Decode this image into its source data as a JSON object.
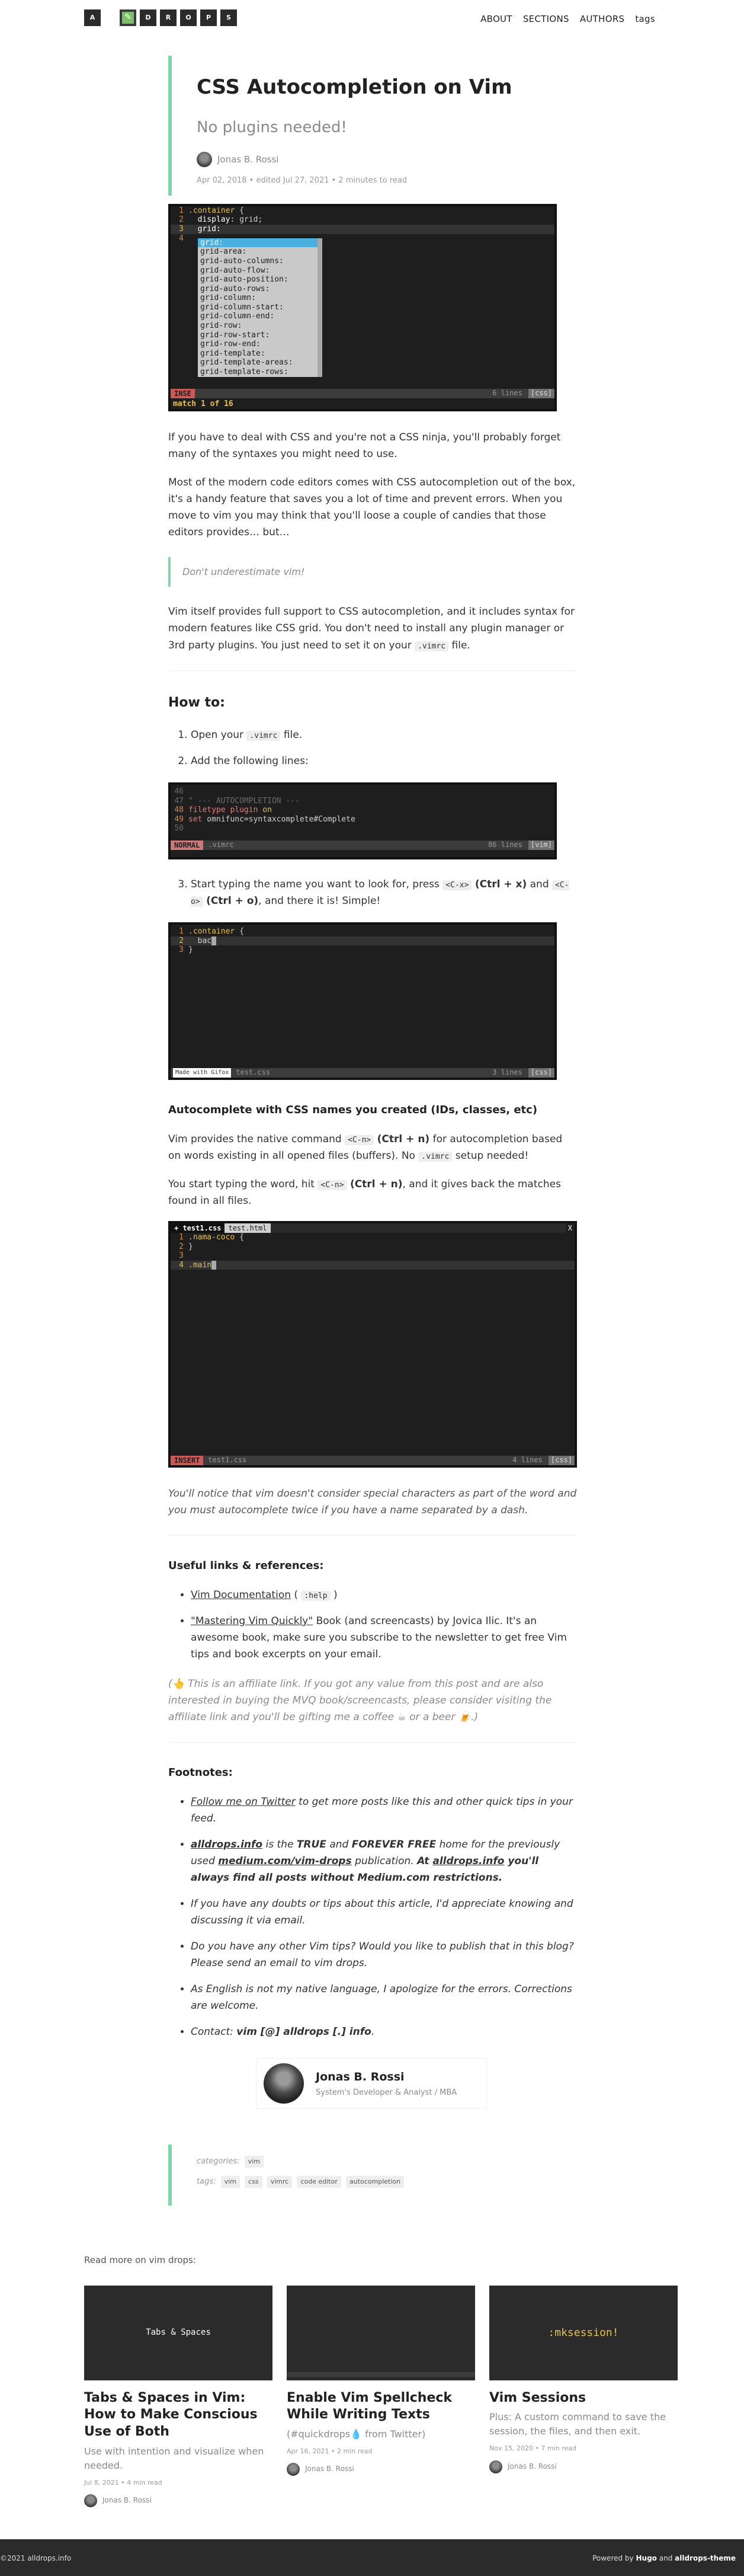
{
  "header": {
    "logo_letters": [
      "A",
      "D",
      "R",
      "O",
      "P",
      "S"
    ],
    "nav": [
      "ABOUT",
      "SECTIONS",
      "AUTHORS",
      "tags"
    ]
  },
  "post": {
    "title": "CSS Autocompletion on Vim",
    "subtitle": "No plugins needed!",
    "author": "Jonas B. Rossi",
    "meta": "Apr 02, 2018 • edited Jul 27, 2021 • 2 minutes to read"
  },
  "term1": {
    "lines": [
      {
        "n": "1",
        "pre": "",
        "sel": ".container",
        "rest": " {"
      },
      {
        "n": "2",
        "pre": "  ",
        "prop": "display",
        "rest": ": grid;"
      },
      {
        "n": "3",
        "pre": "  grid:",
        "rest": ""
      },
      {
        "n": "4",
        "pre": "",
        "rest": ""
      }
    ],
    "popup": [
      "grid:",
      "grid-area:",
      "grid-auto-columns:",
      "grid-auto-flow:",
      "grid-auto-position:",
      "grid-auto-rows:",
      "grid-column:",
      "grid-column-start:",
      "grid-column-end:",
      "grid-row:",
      "grid-row-start:",
      "grid-row-end:",
      "grid-template:",
      "grid-template-areas:",
      "grid-template-rows:"
    ],
    "status_mode": "INSE",
    "status_right": "6 lines",
    "status_tag": "[css]",
    "message": "match 1 of 16"
  },
  "body": {
    "p1": "If you have to deal with CSS and you're not a CSS ninja, you'll probably forget many of the syntaxes you might need to use.",
    "p2": "Most of the modern code editors comes with CSS autocompletion out of the box, it's a handy feature that saves you a lot of time and prevent errors. When you move to vim you may think that you'll loose a couple of candies that those editors provides… but…",
    "quote": "Don't underestimate vim!",
    "p3a": "Vim itself provides full support to CSS autocompletion, and it includes syntax for modern features like CSS grid. You don't need to install any plugin manager or 3rd party plugins. You just need to set it on your",
    "p3_code": ".vimrc",
    "p3b": "file.",
    "howto": "How to:",
    "step1a": "Open your",
    "step1_code": ".vimrc",
    "step1b": "file.",
    "step2": "Add the following lines:",
    "step3a": "Start typing the name you want to look for, press",
    "step3_code1": "<C-x>",
    "step3_k1": "(Ctrl + x)",
    "step3_and": "and",
    "step3_code2": "<C-o>",
    "step3_k2": "(Ctrl + o)",
    "step3b": ", and there it is! Simple!",
    "sub_head": "Autocomplete with CSS names you created (IDs, classes, etc)",
    "p4a": "Vim provides the native command",
    "p4_code": "<C-n>",
    "p4_k": "(Ctrl + n)",
    "p4b": "for autocompletion based on words existing in all opened files (buffers). No",
    "p4_code2": ".vimrc",
    "p4c": "setup needed!",
    "p5a": "You start typing the word, hit",
    "p5_code": "<C-n>",
    "p5_k": "(Ctrl + n)",
    "p5b": ", and it gives back the matches found in all files.",
    "note": "You'll notice that vim doesn't consider special characters as part of the word and you must autocomplete twice if you have a name separated by a dash.",
    "links_head": "Useful links & references:",
    "link1": "Vim Documentation",
    "link1_code": ":help",
    "link2": "\"Mastering Vim Quickly\"",
    "link2_rest": "Book (and screencasts) by Jovica Ilic. It's an awesome book, make sure you subscribe to the newsletter to get free Vim tips and book excerpts on your email.",
    "affiliate": "(👆 This is an affiliate link. If you got any value from this post and are also interested in buying the MVQ book/screencasts, please consider visiting the affiliate link and you'll be gifting me a coffee ☕ or a beer 🍺.)",
    "footnotes_head": "Footnotes:",
    "fn1_link": "Follow me on Twitter",
    "fn1_rest": "to get more posts like this and other quick tips in your feed.",
    "fn2_link1": "alldrops.info",
    "fn2_a": "is the",
    "fn2_true": "TRUE",
    "fn2_and": "and",
    "fn2_free": "FOREVER FREE",
    "fn2_b": "home for the previously used",
    "fn2_link2": "medium.com/vim-drops",
    "fn2_c": "publication.",
    "fn2_d": "At",
    "fn2_link3": "alldrops.info",
    "fn2_e": "you'll always find all posts without Medium.com restrictions.",
    "fn3": "If you have any doubts or tips about this article, I'd appreciate knowing and discussing it via email.",
    "fn4": "Do you have any other Vim tips? Would you like to publish that in this blog? Please send an email to vim drops.",
    "fn5": "As English is not my native language, I apologize for the errors. Corrections are welcome.",
    "fn6_a": "Contact:",
    "fn6_b": "vim [@] alldrops [.] info",
    "fn6_c": "."
  },
  "term2": {
    "lines": [
      {
        "n": "46",
        "text": ""
      },
      {
        "n": "47",
        "text": "\" --- AUTOCOMPLETION ---"
      },
      {
        "n": "48",
        "kw": "filetype",
        "kw2": " plugin",
        "rest": " on"
      },
      {
        "n": "49",
        "kw": "set",
        "rest": " omnifunc=syntaxcomplete#Complete"
      },
      {
        "n": "50",
        "text": ""
      }
    ],
    "status_mode": "NORMAL",
    "status_file": ".vimrc",
    "status_right": "86 lines",
    "status_tag": "[vim]"
  },
  "term3": {
    "lines": [
      {
        "n": "1",
        "sel": ".container",
        "rest": " {"
      },
      {
        "n": "2",
        "text": "  bac"
      },
      {
        "n": "3",
        "text": "}"
      }
    ],
    "status_file": "test.css",
    "status_right": "3 lines",
    "status_tag": "[css]",
    "badge": "Made with Gifox"
  },
  "term4": {
    "tabs": [
      "test1.css",
      "test.html"
    ],
    "lines": [
      {
        "n": "1",
        "sel": ".nama-coco",
        "rest": " {"
      },
      {
        "n": "2",
        "text": "}"
      },
      {
        "n": "3",
        "text": ""
      },
      {
        "n": "4",
        "text": ".main"
      }
    ],
    "status_mode": "INSERT",
    "status_file": "test1.css",
    "status_right": "4 lines",
    "status_tag": "[css]"
  },
  "author_card": {
    "name": "Jonas B. Rossi",
    "role": "System's Developer & Analyst / MBA"
  },
  "taxonomy": {
    "categories_label": "categories:",
    "categories": [
      "vim"
    ],
    "tags_label": "tags:",
    "tags": [
      "vim",
      "css",
      "vimrc",
      "code editor",
      "autocompletion"
    ]
  },
  "read_more": {
    "title": "Read more on vim drops:",
    "cards": [
      {
        "thumb": "Tabs & Spaces",
        "title": "Tabs & Spaces in Vim: How to Make Conscious Use of Both",
        "sub": "Use with intention and visualize when needed.",
        "meta": "Jul 8, 2021 • 4 min read",
        "author": "Jonas B. Rossi"
      },
      {
        "thumb": "",
        "title": "Enable Vim Spellcheck While Writing Texts",
        "sub": "(#quickdrops💧 from Twitter)",
        "meta": "Apr 16, 2021 • 2 min read",
        "author": "Jonas B. Rossi"
      },
      {
        "thumb": ":mksession!",
        "title": "Vim Sessions",
        "sub": "Plus: A custom command to save the session, the files, and then exit.",
        "meta": "Nov 15, 2020 • 7 min read",
        "author": "Jonas B. Rossi"
      }
    ]
  },
  "footer": {
    "left": "©2021 alldrops.info",
    "right_a": "Powered by",
    "right_hugo": "Hugo",
    "right_and": "and",
    "right_theme": "alldrops-theme"
  }
}
